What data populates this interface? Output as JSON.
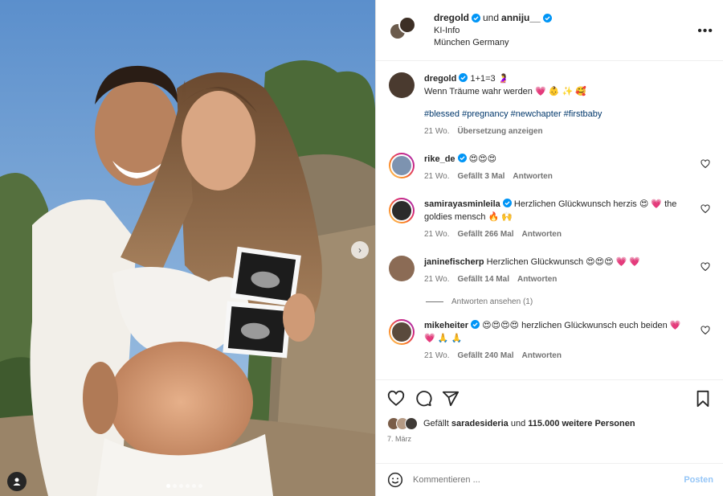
{
  "post": {
    "author": "dregold",
    "and_label": "und",
    "coauthor": "anniju__",
    "audio_label": "KI-Info",
    "location": "München Germany",
    "more_label": "•••"
  },
  "caption": {
    "username": "dregold",
    "line1": "1+1=3 🤰",
    "line2": "Wenn Träume wahr werden 💗 👶 ✨ 🥰",
    "hashtags": "#blessed #pregnancy #newchapter #firstbaby",
    "time": "21 Wo.",
    "translate": "Übersetzung anzeigen"
  },
  "comments": [
    {
      "username": "rike_de",
      "text": "😍😍😍",
      "time": "21 Wo.",
      "likes": "Gefällt 3 Mal",
      "reply": "Antworten"
    },
    {
      "username": "samirayasminleila",
      "text": "Herzlichen Glückwunsch herzis 😍 💗 the goldies mensch 🔥 🙌",
      "time": "21 Wo.",
      "likes": "Gefällt 266 Mal",
      "reply": "Antworten"
    },
    {
      "username": "janinefischerp",
      "text": "Herzlichen Glückwunsch 😍😍😍 💗 💗",
      "time": "21 Wo.",
      "likes": "Gefällt 14 Mal",
      "reply": "Antworten"
    },
    {
      "username": "mikeheiter",
      "text": "😍😍😍😍 herzlichen Glückwunsch euch beiden 💗 💗 🙏 🙏",
      "time": "21 Wo.",
      "likes": "Gefällt 240 Mal",
      "reply": "Antworten"
    }
  ],
  "view_replies": "Antworten ansehen (1)",
  "likes_summary": {
    "prefix": "Gefällt",
    "user": "saradesideria",
    "middle": "und",
    "count": "115.000 weitere Personen"
  },
  "date": "7. März",
  "comment_input": {
    "placeholder": "Kommentieren ...",
    "post_label": "Posten"
  },
  "carousel": {
    "slide_count": 6,
    "active_index": 0
  },
  "colors": {
    "verified": "#0095f6",
    "link": "#00376b",
    "post_disabled": "#95c6f7"
  }
}
